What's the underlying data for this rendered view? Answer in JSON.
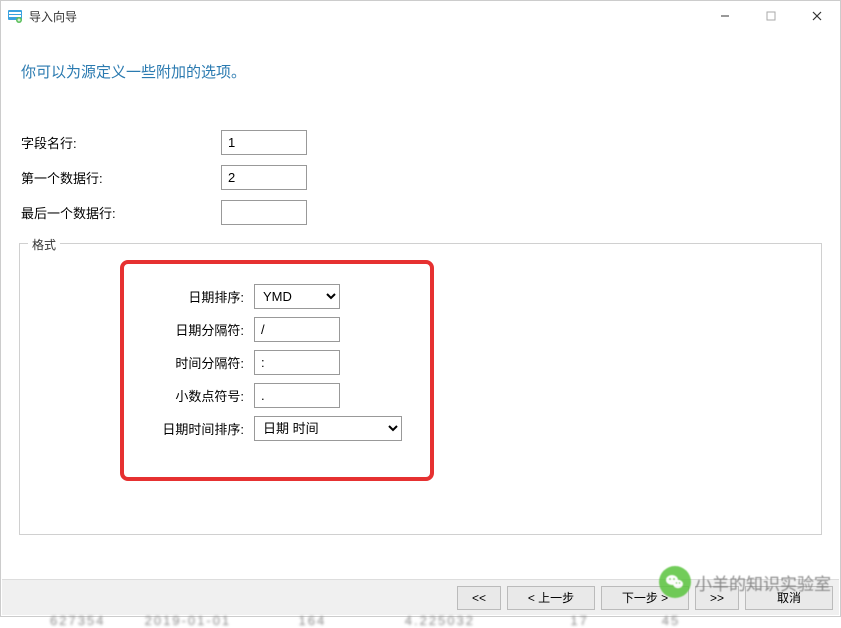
{
  "window": {
    "title": "导入向导"
  },
  "heading": "你可以为源定义一些附加的选项。",
  "fields": {
    "field_name_row": {
      "label": "字段名行:",
      "value": "1"
    },
    "first_data_row": {
      "label": "第一个数据行:",
      "value": "2"
    },
    "last_data_row": {
      "label": "最后一个数据行:",
      "value": ""
    }
  },
  "format": {
    "legend": "格式",
    "date_order": {
      "label": "日期排序:",
      "value": "YMD"
    },
    "date_separator": {
      "label": "日期分隔符:",
      "value": "/"
    },
    "time_separator": {
      "label": "时间分隔符:",
      "value": ":"
    },
    "decimal_symbol": {
      "label": "小数点符号:",
      "value": "."
    },
    "datetime_order": {
      "label": "日期时间排序:",
      "value": "日期 时间"
    }
  },
  "buttons": {
    "rewind": "<<",
    "prev": "< 上一步",
    "next": "下一步 >",
    "fast": ">>",
    "cancel": "取消"
  },
  "watermark": "小羊的知识实验室",
  "bg_row": "627354       2019-01-01            164              4.225032                 17             45"
}
